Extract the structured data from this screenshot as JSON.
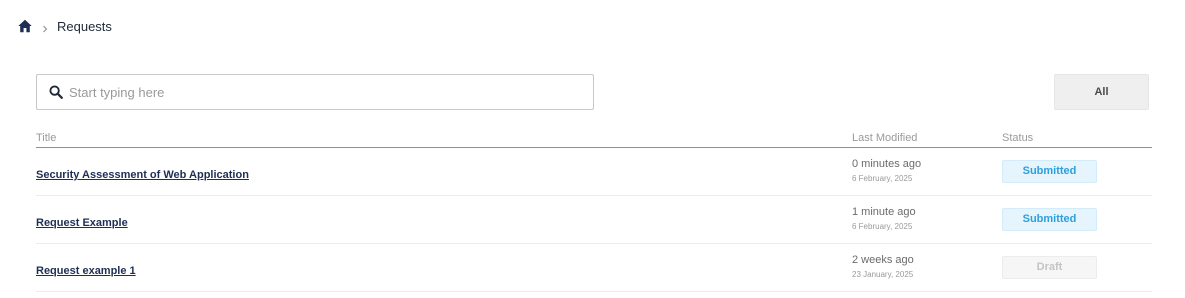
{
  "breadcrumb": {
    "current": "Requests"
  },
  "search": {
    "placeholder": "Start typing here",
    "value": ""
  },
  "filter": {
    "label": "All"
  },
  "table": {
    "headers": {
      "title": "Title",
      "last_modified": "Last Modified",
      "status": "Status"
    },
    "rows": [
      {
        "title": "Security Assessment of Web Application",
        "modified_relative": "0 minutes ago",
        "modified_date": "6 February, 2025",
        "status": "Submitted"
      },
      {
        "title": "Request Example",
        "modified_relative": "1 minute ago",
        "modified_date": "6 February, 2025",
        "status": "Submitted"
      },
      {
        "title": "Request example 1",
        "modified_relative": "2 weeks ago",
        "modified_date": "23 January, 2025",
        "status": "Draft"
      }
    ]
  },
  "colors": {
    "brand_navy": "#1e2f55",
    "submitted_text": "#2f9fd9",
    "submitted_bg": "#e6f4fd",
    "draft_text": "#c4c4c4"
  },
  "icons": {
    "home": "home-icon",
    "separator": "chevron-right-icon",
    "search": "search-icon"
  }
}
